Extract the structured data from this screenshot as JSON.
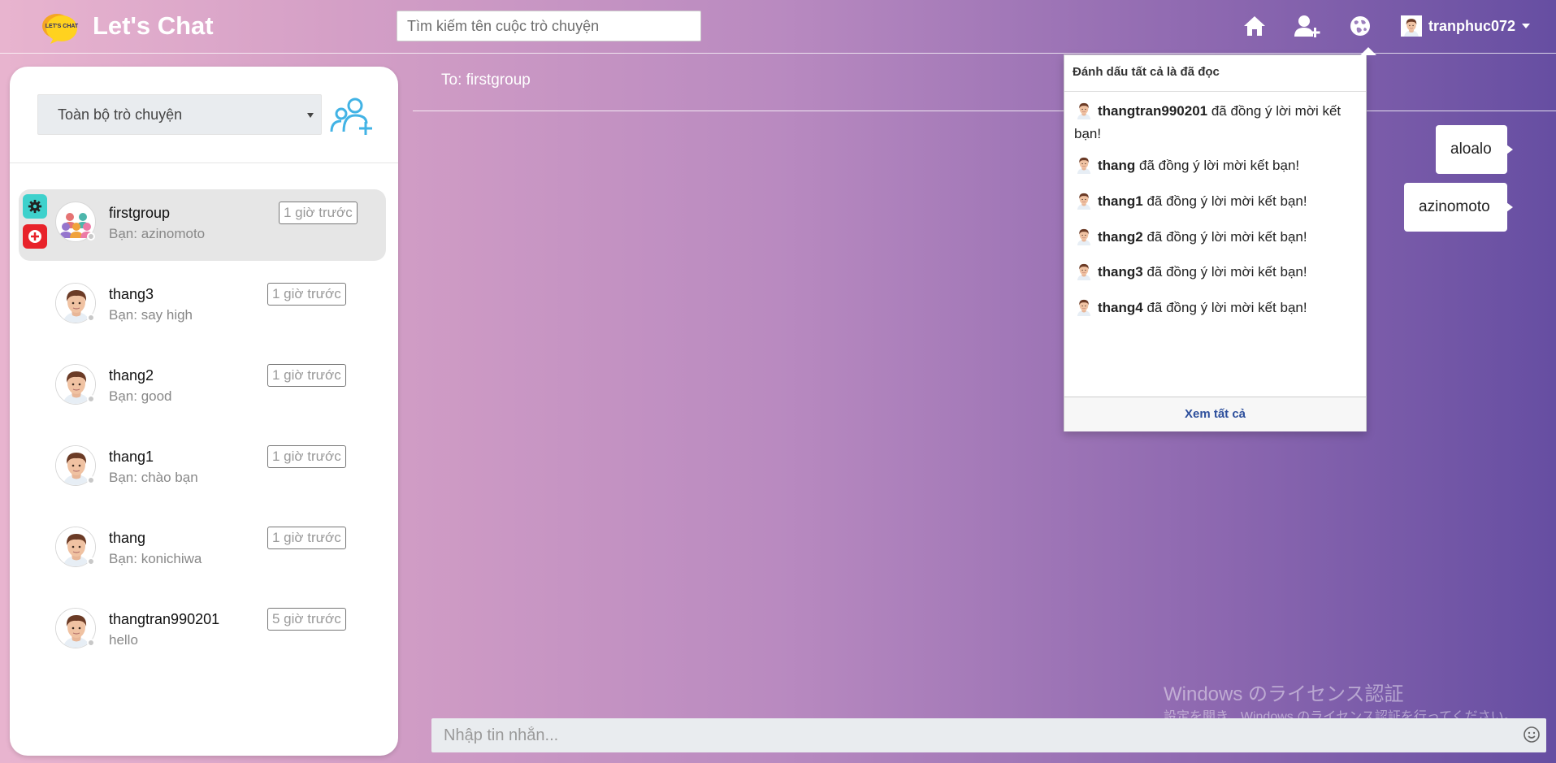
{
  "app": {
    "brand": "Let's Chat",
    "logo_text": "LET'S CHAT"
  },
  "header": {
    "search_placeholder": "Tìm kiếm tên cuộc trò chuyện",
    "username": "tranphuc072"
  },
  "sidebar": {
    "filter_label": "Toàn bộ trò chuyện",
    "conversations": [
      {
        "name": "firstgroup",
        "preview": "Bạn: azinomoto",
        "time": "1 giờ trước",
        "active": true,
        "type": "group"
      },
      {
        "name": "thang3",
        "preview": "Bạn: say high",
        "time": "1 giờ trước"
      },
      {
        "name": "thang2",
        "preview": "Bạn: good",
        "time": "1 giờ trước"
      },
      {
        "name": "thang1",
        "preview": "Bạn: chào bạn",
        "time": "1 giờ trước"
      },
      {
        "name": "thang",
        "preview": "Bạn: konichiwa",
        "time": "1 giờ trước"
      },
      {
        "name": "thangtran990201",
        "preview": "hello",
        "time": "5 giờ trước"
      }
    ]
  },
  "chat": {
    "to_label": "To: firstgroup",
    "messages": [
      "aloalo",
      "azinomoto"
    ],
    "input_placeholder": "Nhập tin nhắn..."
  },
  "notifications": {
    "header": "Đánh dấu tất cả là đã đọc",
    "items": [
      {
        "user": "thangtran990201",
        "text": " đã đồng ý lời mời kết bạn!"
      },
      {
        "user": "thang",
        "text": " đã đồng ý lời mời kết bạn!"
      },
      {
        "user": "thang1",
        "text": " đã đồng ý lời mời kết bạn!"
      },
      {
        "user": "thang2",
        "text": " đã đồng ý lời mời kết bạn!"
      },
      {
        "user": "thang3",
        "text": " đã đồng ý lời mời kết bạn!"
      },
      {
        "user": "thang4",
        "text": " đã đồng ý lời mời kết bạn!"
      }
    ],
    "footer": "Xem tất cả"
  },
  "watermark": {
    "line1": "Windows のライセンス認証",
    "line2": "設定を開き、Windows のライセンス認証を行ってください。"
  },
  "colors": {
    "accent_blue": "#42b3e5",
    "teal": "#3ed1cc",
    "red": "#e8222a",
    "link": "#2d4f9c"
  },
  "icons": [
    "home-icon",
    "add-friend-icon",
    "globe-icon",
    "user-avatar",
    "gear-icon",
    "leave-group-icon",
    "add-group-icon",
    "emoji-icon"
  ]
}
